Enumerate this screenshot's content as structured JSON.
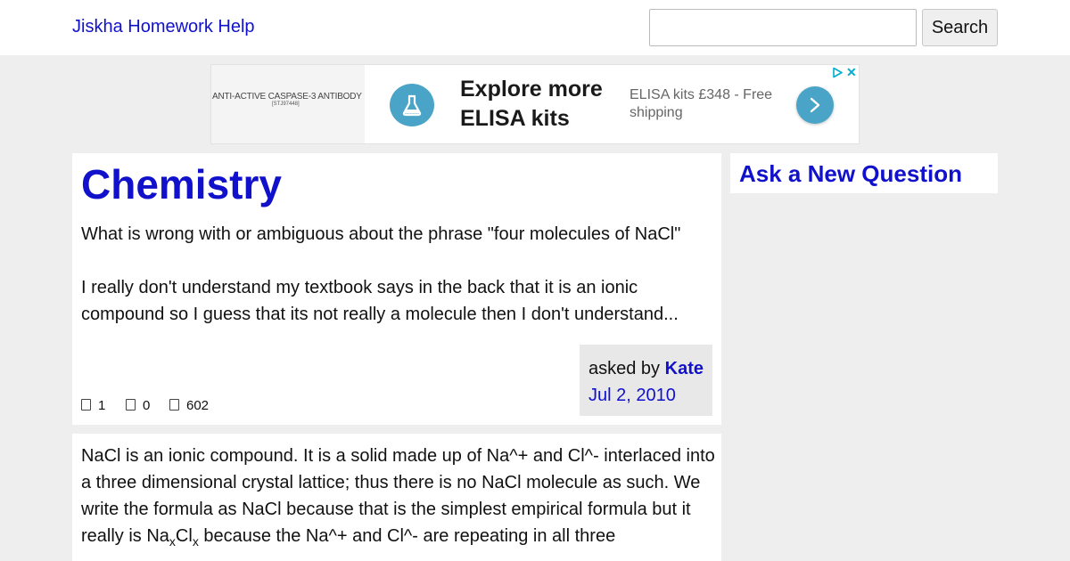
{
  "header": {
    "brand": "Jiskha Homework Help",
    "search_value": "",
    "search_button": "Search"
  },
  "ad": {
    "thumb_text": "ANTI-ACTIVE CASPASE-3 ANTIBODY",
    "thumb_subtext": "[STJ97448]",
    "headline": "Explore more ELISA kits",
    "description": "ELISA kits £348 - Free shipping",
    "accent_color": "#4aa4c8",
    "icons": [
      "flask-icon",
      "chevron-right-icon",
      "adchoices-icon",
      "close-icon"
    ],
    "close_glyph": "✕"
  },
  "question": {
    "title": "Chemistry",
    "paragraphs": [
      "What is wrong with or ambiguous about the phrase \"four molecules of NaCl\"",
      "I really don't understand my textbook says in the back that it is an ionic compound so I guess that its not really a molecule then I don't understand..."
    ],
    "stats": [
      {
        "icon": "thumbs-up-icon",
        "value": "1"
      },
      {
        "icon": "thumbs-down-icon",
        "value": "0"
      },
      {
        "icon": "views-icon",
        "value": "602"
      }
    ],
    "asked_prefix": "asked by",
    "asker": "Kate",
    "date": "Jul 2, 2010"
  },
  "answer": {
    "text_before": "NaCl is an ionic compound. It is a solid made up of Na^+ and Cl^- interlaced into a three dimensional crystal lattice; thus there is no NaCl molecule as such. We write the formula as NaCl because that is the simplest empirical formula but it really is Na",
    "sub1": "x",
    "mid": "Cl",
    "sub2": "x",
    "text_after": " because the Na^+ and Cl^- are repeating in all three"
  },
  "sidebar": {
    "ask_link": "Ask a New Question"
  },
  "colors": {
    "link": "#1111cc",
    "page_bg": "#eeeeee",
    "asker_box_bg": "#e8e8e8"
  }
}
